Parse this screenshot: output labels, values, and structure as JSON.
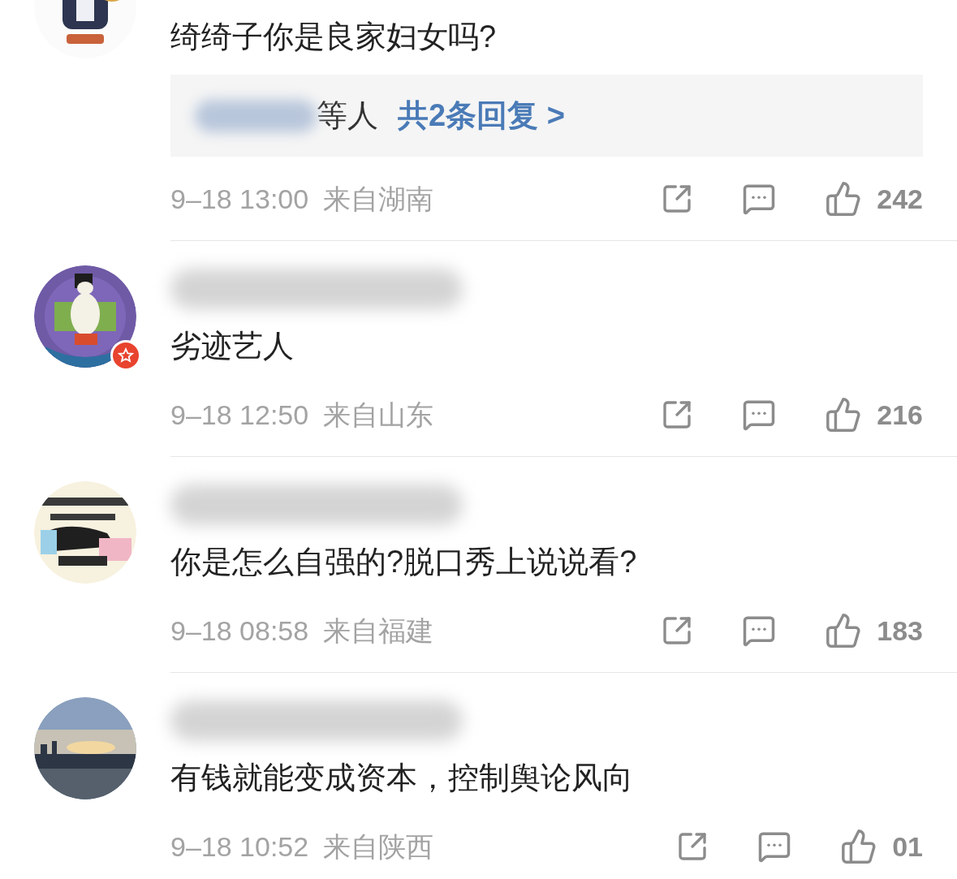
{
  "comments": [
    {
      "text": "绮绮子你是良家妇女吗?",
      "verified": false,
      "replies": {
        "suffix": "等人",
        "link": "共2条回复 >"
      },
      "time": "9–18 13:00",
      "location": "来自湖南",
      "likes": "242"
    },
    {
      "text": "劣迹艺人",
      "verified": true,
      "time": "9–18 12:50",
      "location": "来自山东",
      "likes": "216"
    },
    {
      "text": "你是怎么自强的?脱口秀上说说看?",
      "verified": false,
      "time": "9–18 08:58",
      "location": "来自福建",
      "likes": "183"
    },
    {
      "text": "有钱就能变成资本，控制舆论风向",
      "verified": false,
      "time": "9–18 10:52",
      "location": "来自陕西",
      "likes": "01"
    }
  ]
}
